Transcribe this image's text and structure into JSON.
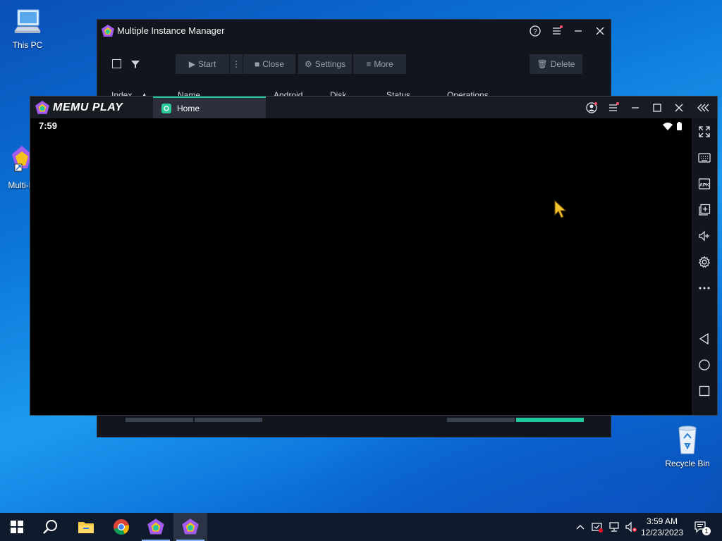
{
  "desktop": {
    "icons": [
      {
        "label": "This PC"
      },
      {
        "label": "Multi-M"
      },
      {
        "label": "Recycle Bin"
      }
    ]
  },
  "instance_manager": {
    "title": "Multiple Instance Manager",
    "toolbar": {
      "start_label": "Start",
      "close_label": "Close",
      "settings_label": "Settings",
      "more_label": "More",
      "delete_label": "Delete"
    },
    "columns": [
      "Index",
      "Name",
      "Android",
      "Disk",
      "Status",
      "Operations"
    ]
  },
  "memu": {
    "brand": "MEMU PLAY",
    "tab_label": "Home",
    "android_time": "7:59"
  },
  "taskbar": {
    "time": "3:59 AM",
    "date": "12/23/2023",
    "notification_count": "1"
  },
  "colors": {
    "accent": "#1ec8a0",
    "window_bg": "#12151c",
    "desktop_blue": "#0b74d6"
  }
}
